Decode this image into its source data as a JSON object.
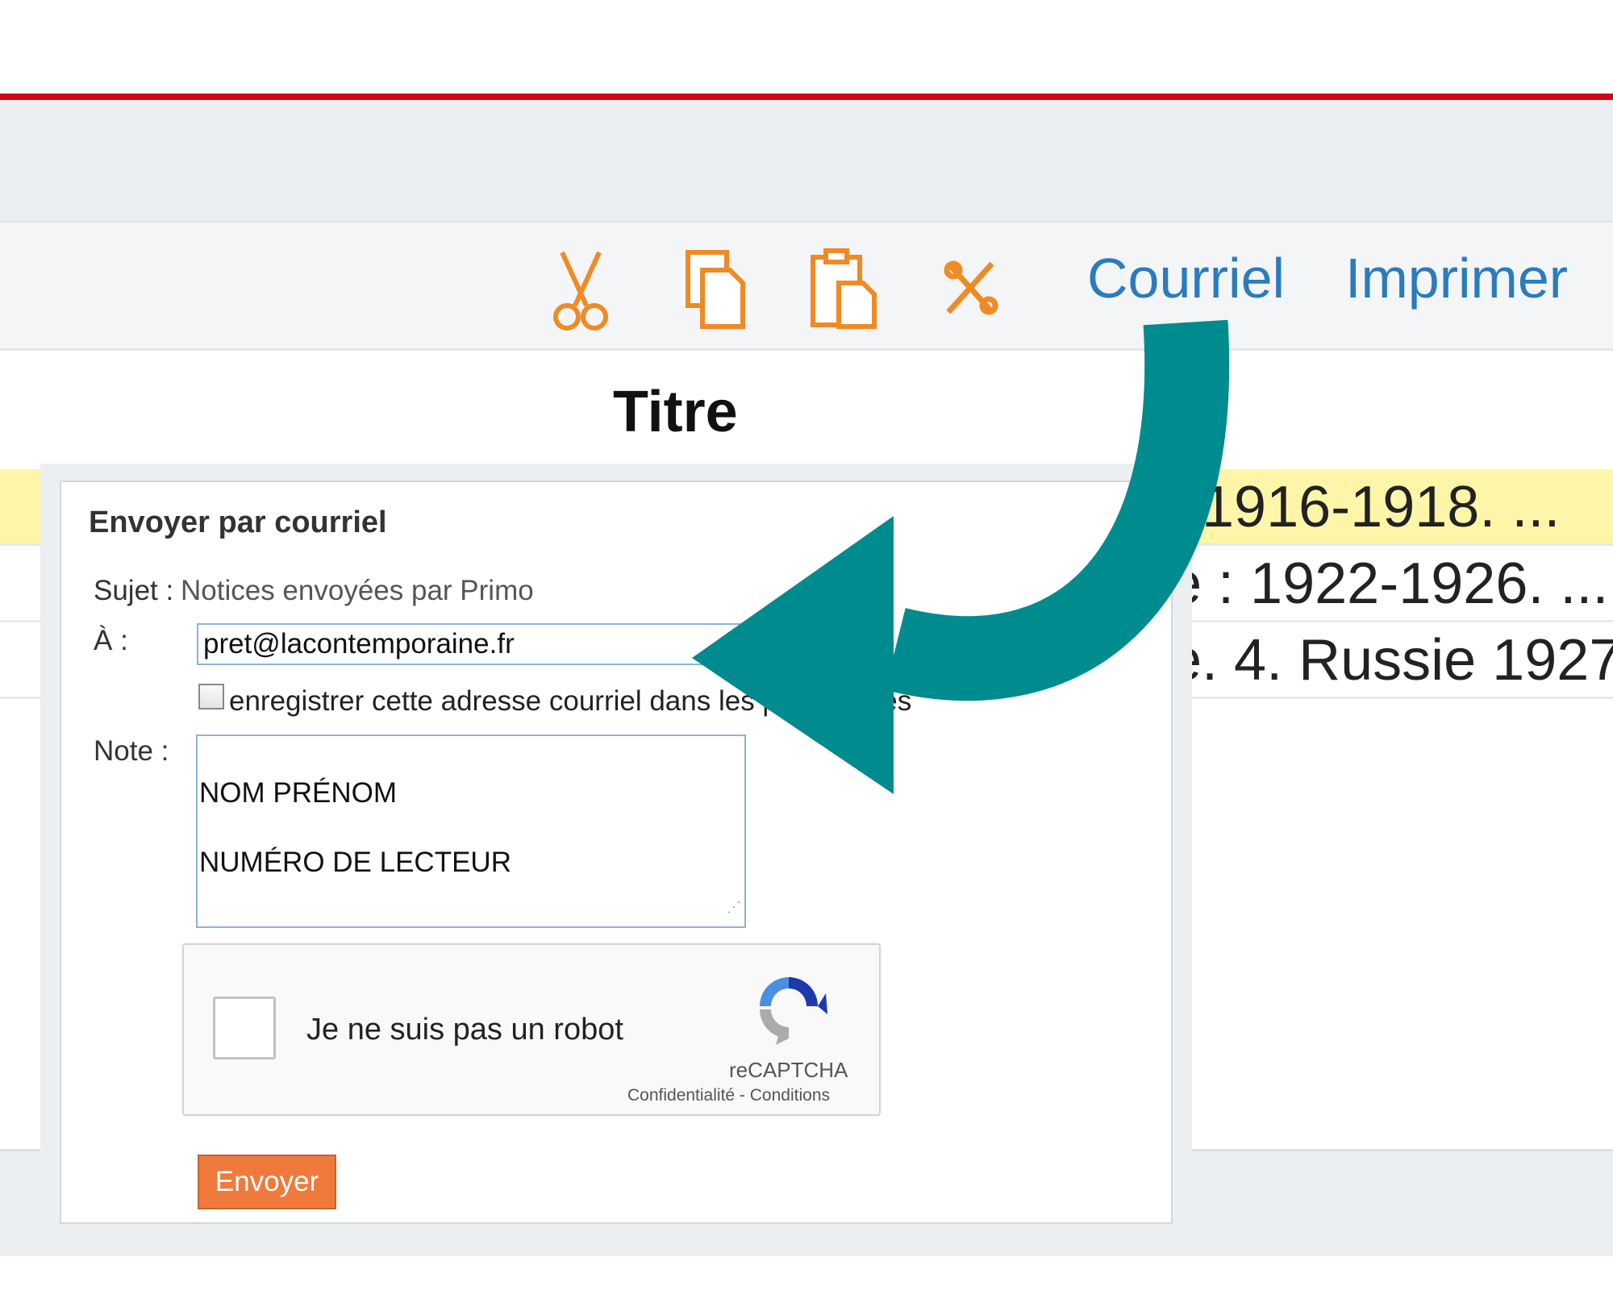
{
  "toolbar": {
    "icons": [
      "scissors-icon",
      "copy-icon",
      "paste-icon",
      "clear-icon"
    ],
    "courriel_label": "Courriel",
    "imprimer_label": "Imprimer",
    "icon_color": "#f08a24",
    "link_color": "#2a7bbf"
  },
  "results": {
    "header_title": "Titre",
    "rows": [
      {
        "text": ": 1916-1918. ...",
        "highlighted": true
      },
      {
        "text": "e : 1922-1926. ...",
        "highlighted": false
      },
      {
        "text": "e. 4. Russie 1927",
        "highlighted": false
      }
    ]
  },
  "dialog": {
    "title": "Envoyer par courriel",
    "subject_label": "Sujet :",
    "subject_value": "Notices envoyées par Primo",
    "to_label": "À :",
    "to_value": "pret@lacontemporaine.fr",
    "save_checkbox_label": "enregistrer cette adresse courriel dans les préférences",
    "note_label": "Note :",
    "note_value": "NOM PRÉNOM\n\nNUMÉRO DE LECTEUR",
    "captcha": {
      "label": "Je ne suis pas un robot",
      "brand": "reCAPTCHA",
      "privacy_link": "Confidentialité",
      "separator": " - ",
      "terms_link": "Conditions"
    },
    "send_button": "Envoyer"
  },
  "overlay": {
    "arrow_color": "#008b8f",
    "arrow_icon": "curved-arrow-icon"
  },
  "colors": {
    "accent_red": "#d0021b",
    "highlight_row": "#fdf6a8",
    "send_button": "#f07a3b"
  }
}
